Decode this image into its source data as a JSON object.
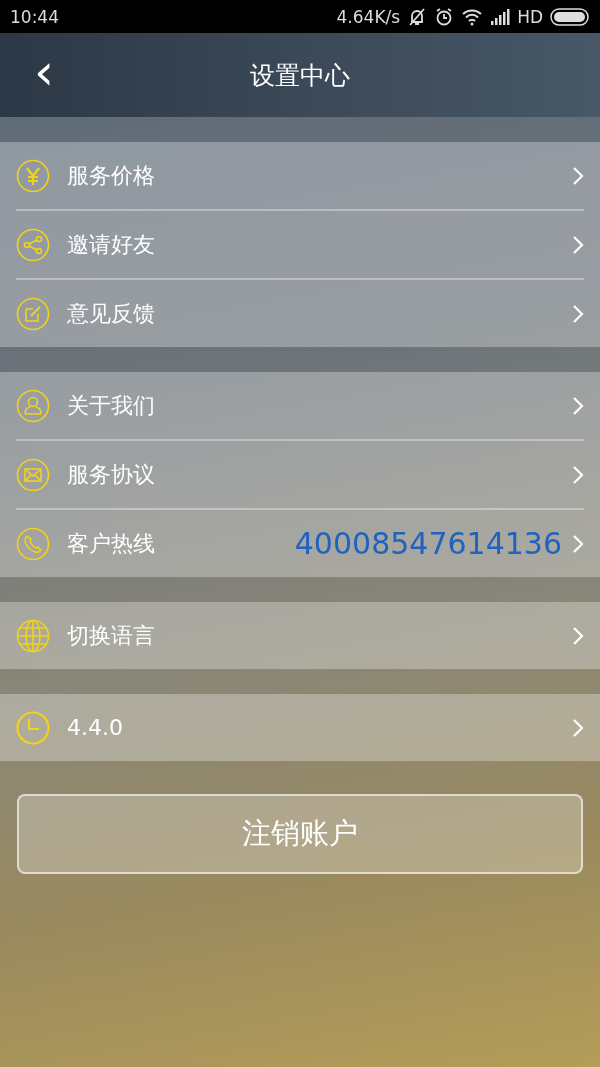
{
  "status_bar": {
    "time": "10:44",
    "speed": "4.64K/s",
    "network": "HD"
  },
  "header": {
    "back": "‹",
    "title": "设置中心"
  },
  "groups": [
    {
      "items": [
        {
          "kind": "yen",
          "label": "服务价格"
        },
        {
          "kind": "share",
          "label": "邀请好友"
        },
        {
          "kind": "edit",
          "label": "意见反馈"
        }
      ]
    },
    {
      "items": [
        {
          "kind": "person",
          "label": "关于我们"
        },
        {
          "kind": "mail",
          "label": "服务协议"
        },
        {
          "kind": "phone",
          "label": "客户热线",
          "value": "40008547614136"
        }
      ]
    },
    {
      "items": [
        {
          "kind": "globe",
          "label": "切换语言"
        }
      ]
    },
    {
      "items": [
        {
          "kind": "clock",
          "label": "4.4.0"
        }
      ]
    }
  ],
  "logout_button": "注销账户"
}
